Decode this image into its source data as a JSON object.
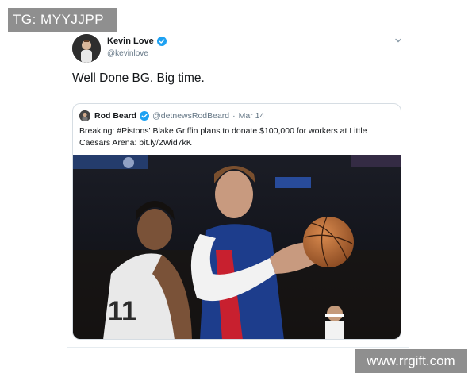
{
  "watermarks": {
    "top_left": "TG: MYYJJPP",
    "bottom_right": "www.rrgift.com"
  },
  "tweet": {
    "author_name": "Kevin Love",
    "author_handle": "@kevinlove",
    "text": "Well Done BG. Big time."
  },
  "quoted_tweet": {
    "author_name": "Rod Beard",
    "author_handle": "@detnewsRodBeard",
    "separator": "·",
    "date": "Mar 14",
    "text": "Breaking: #Pistons' Blake Griffin plans to donate $100,000 for workers at Little Caesars Arena: bit.ly/2Wid7kK"
  },
  "icons": {
    "verified": "verified-badge-icon",
    "menu": "chevron-down-icon"
  },
  "colors": {
    "verified": "#1da1f2",
    "handle": "#657786",
    "border": "#d6dde3"
  }
}
